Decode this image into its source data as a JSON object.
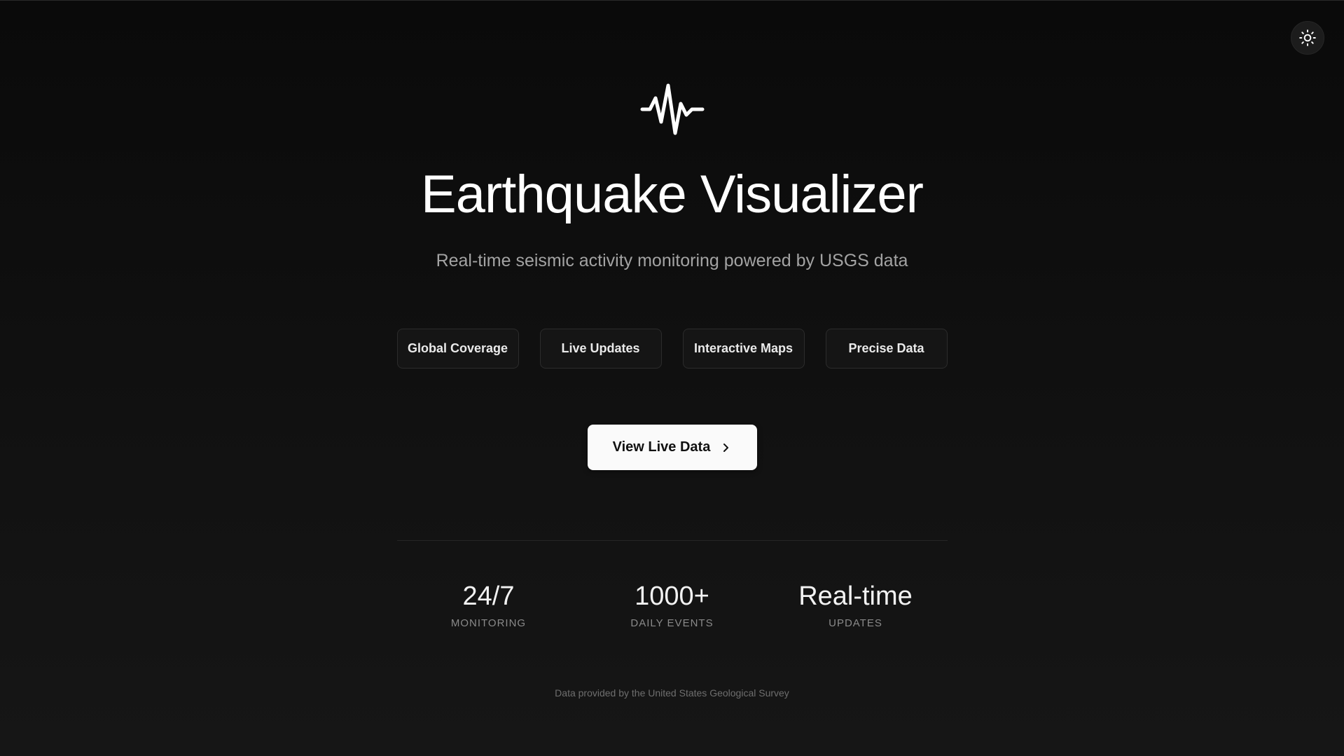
{
  "app": {
    "title": "Earthquake Visualizer",
    "subtitle": "Real-time seismic activity monitoring powered by USGS data",
    "logo_icon": "seismic-wave-icon"
  },
  "header": {
    "theme_toggle_icon": "sun-icon"
  },
  "features": [
    {
      "label": "Global Coverage"
    },
    {
      "label": "Live Updates"
    },
    {
      "label": "Interactive Maps"
    },
    {
      "label": "Precise Data"
    }
  ],
  "cta": {
    "label": "View Live Data",
    "icon": "chevron-right-icon"
  },
  "stats": [
    {
      "value": "24/7",
      "label": "MONITORING"
    },
    {
      "value": "1000+",
      "label": "DAILY EVENTS"
    },
    {
      "value": "Real-time",
      "label": "UPDATES"
    }
  ],
  "footer": {
    "text": "Data provided by the United States Geological Survey"
  },
  "colors": {
    "background": "#0a0a0a",
    "cta_background": "#fafafa",
    "text_primary": "#ffffff",
    "text_muted": "#a3a3a3"
  }
}
